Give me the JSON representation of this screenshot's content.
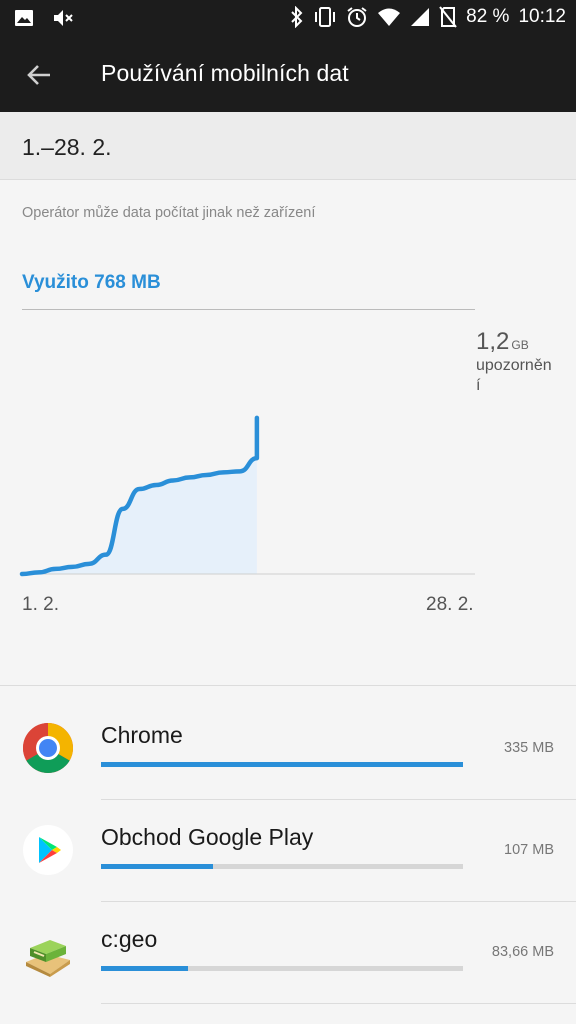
{
  "status_bar": {
    "battery": "82 %",
    "time": "10:12",
    "icons": [
      "image-icon",
      "mute-icon",
      "bluetooth-icon",
      "vibrate-icon",
      "alarm-icon",
      "wifi-icon",
      "signal-icon",
      "no-sim-icon"
    ]
  },
  "header": {
    "title": "Používání mobilních dat",
    "back_icon": "arrow-back-icon"
  },
  "period": {
    "label": "1.–28. 2."
  },
  "note": "Operátor může data počítat jinak než zařízení",
  "usage": {
    "used_label": "Využito 768 MB",
    "warning_value": "1,2",
    "warning_unit": "GB",
    "warning_text": "upozornění"
  },
  "colors": {
    "accent": "#2a8fd8",
    "app_bar": "#1c1c1c",
    "background": "#f5f5f5"
  },
  "chart_data": {
    "type": "area",
    "x_start_label": "1. 2.",
    "x_end_label": "28. 2.",
    "ylim": [
      0,
      1200
    ],
    "y_unit": "MB",
    "x_days_total": 28,
    "x": [
      1,
      2,
      3,
      4,
      5,
      6,
      7,
      8,
      9,
      10,
      11,
      12,
      13,
      14,
      15
    ],
    "values": [
      0,
      8,
      25,
      35,
      50,
      95,
      320,
      418,
      438,
      460,
      475,
      487,
      500,
      505,
      570
    ],
    "last_value": 768,
    "last_x": 15
  },
  "apps": [
    {
      "name": "Chrome",
      "size": "335 MB",
      "fraction": 1.0,
      "icon": "chrome-icon"
    },
    {
      "name": "Obchod Google Play",
      "size": "107 MB",
      "fraction": 0.31,
      "icon": "play-store-icon"
    },
    {
      "name": "c:geo",
      "size": "83,66 MB",
      "fraction": 0.24,
      "icon": "cgeo-icon"
    }
  ]
}
